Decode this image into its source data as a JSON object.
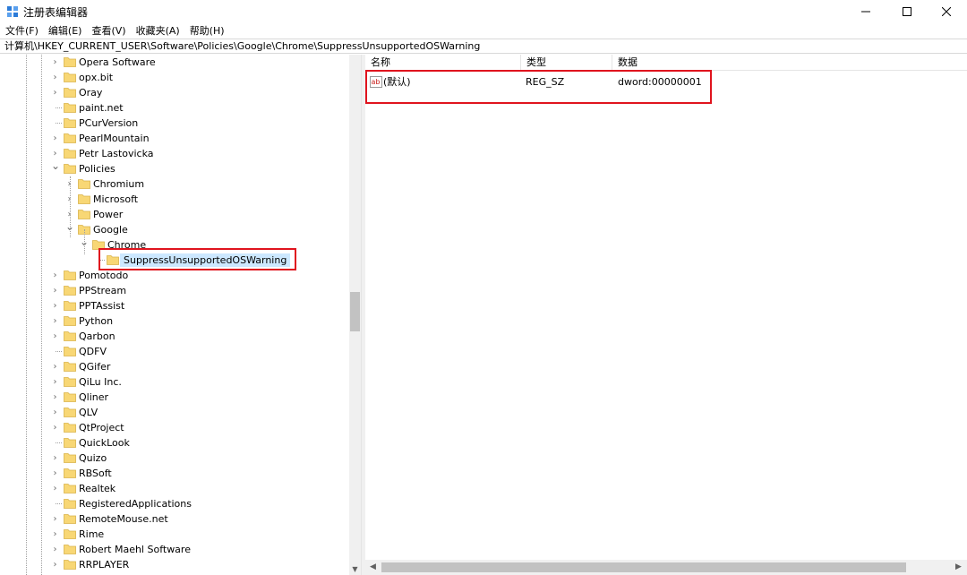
{
  "window": {
    "title": "注册表编辑器",
    "minimize_glyph": "—",
    "maximize_glyph": "☐",
    "close_glyph": "✕"
  },
  "menu": [
    "文件(F)",
    "编辑(E)",
    "查看(V)",
    "收藏夹(A)",
    "帮助(H)"
  ],
  "address": "计算机\\HKEY_CURRENT_USER\\Software\\Policies\\Google\\Chrome\\SuppressUnsupportedOSWarning",
  "tree": [
    {
      "label": "Opera Software",
      "level": 0,
      "expander": "collapsed"
    },
    {
      "label": "opx.bit",
      "level": 0,
      "expander": "collapsed"
    },
    {
      "label": "Oray",
      "level": 0,
      "expander": "collapsed"
    },
    {
      "label": "paint.net",
      "level": 0,
      "expander": "none"
    },
    {
      "label": "PCurVersion",
      "level": 0,
      "expander": "none"
    },
    {
      "label": "PearlMountain",
      "level": 0,
      "expander": "collapsed"
    },
    {
      "label": "Petr Lastovicka",
      "level": 0,
      "expander": "collapsed"
    },
    {
      "label": "Policies",
      "level": 0,
      "expander": "expanded"
    },
    {
      "label": "Chromium",
      "level": 1,
      "expander": "collapsed"
    },
    {
      "label": "Microsoft",
      "level": 1,
      "expander": "collapsed"
    },
    {
      "label": "Power",
      "level": 1,
      "expander": "collapsed"
    },
    {
      "label": "Google",
      "level": 1,
      "expander": "expanded"
    },
    {
      "label": "Chrome",
      "level": 2,
      "expander": "expanded"
    },
    {
      "label": "SuppressUnsupportedOSWarning",
      "level": 3,
      "expander": "none",
      "selected": true
    },
    {
      "label": "Pomotodo",
      "level": 0,
      "expander": "collapsed"
    },
    {
      "label": "PPStream",
      "level": 0,
      "expander": "collapsed"
    },
    {
      "label": "PPTAssist",
      "level": 0,
      "expander": "collapsed"
    },
    {
      "label": "Python",
      "level": 0,
      "expander": "collapsed"
    },
    {
      "label": "Qarbon",
      "level": 0,
      "expander": "collapsed"
    },
    {
      "label": "QDFV",
      "level": 0,
      "expander": "none"
    },
    {
      "label": "QGifer",
      "level": 0,
      "expander": "collapsed"
    },
    {
      "label": "QiLu Inc.",
      "level": 0,
      "expander": "collapsed"
    },
    {
      "label": "Qliner",
      "level": 0,
      "expander": "collapsed"
    },
    {
      "label": "QLV",
      "level": 0,
      "expander": "collapsed"
    },
    {
      "label": "QtProject",
      "level": 0,
      "expander": "collapsed"
    },
    {
      "label": "QuickLook",
      "level": 0,
      "expander": "none"
    },
    {
      "label": "Quizo",
      "level": 0,
      "expander": "collapsed"
    },
    {
      "label": "RBSoft",
      "level": 0,
      "expander": "collapsed"
    },
    {
      "label": "Realtek",
      "level": 0,
      "expander": "collapsed"
    },
    {
      "label": "RegisteredApplications",
      "level": 0,
      "expander": "none"
    },
    {
      "label": "RemoteMouse.net",
      "level": 0,
      "expander": "collapsed"
    },
    {
      "label": "Rime",
      "level": 0,
      "expander": "collapsed"
    },
    {
      "label": "Robert Maehl Software",
      "level": 0,
      "expander": "collapsed"
    },
    {
      "label": "RRPLAYER",
      "level": 0,
      "expander": "collapsed"
    }
  ],
  "columns": {
    "name": "名称",
    "type": "类型",
    "data": "数据"
  },
  "values": [
    {
      "name": "(默认)",
      "type": "REG_SZ",
      "data": "dword:00000001",
      "icon": "ab-string-icon"
    }
  ],
  "colors": {
    "highlight": "#e0141e",
    "selection": "#cce8ff",
    "folder": "#f8d775"
  }
}
